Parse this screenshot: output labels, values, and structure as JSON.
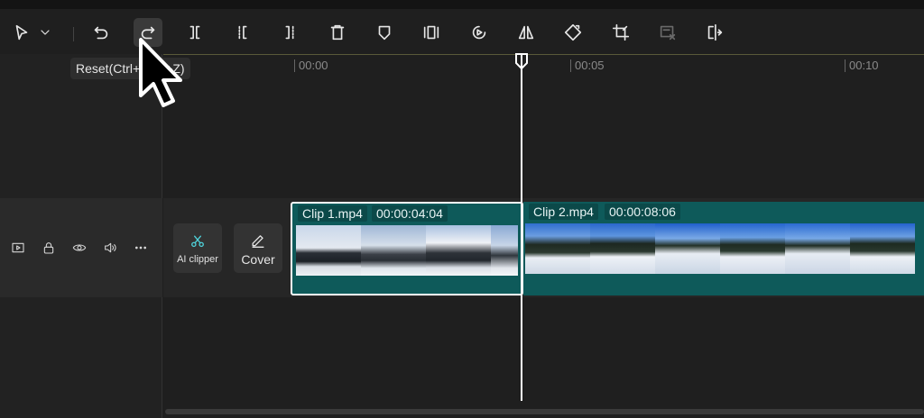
{
  "toolbar": {
    "items": [
      {
        "name": "select-tool-icon"
      },
      {
        "name": "chevron-down-icon"
      },
      {
        "name": "undo-icon"
      },
      {
        "name": "redo-icon"
      },
      {
        "name": "split-icon"
      },
      {
        "name": "split-left-icon"
      },
      {
        "name": "split-right-icon"
      },
      {
        "name": "delete-icon"
      },
      {
        "name": "marker-icon"
      },
      {
        "name": "freeze-frame-icon"
      },
      {
        "name": "speed-icon"
      },
      {
        "name": "mirror-icon"
      },
      {
        "name": "rotate-icon"
      },
      {
        "name": "crop-icon"
      },
      {
        "name": "remove-background-icon"
      },
      {
        "name": "replace-icon"
      }
    ],
    "tooltip": "Reset(Ctrl+Shift+Z)"
  },
  "ruler": {
    "ticks": [
      "00:00",
      "00:05",
      "00:10"
    ]
  },
  "track": {
    "tools": [
      {
        "label": "AI clipper",
        "icon": "ai-clipper-icon"
      },
      {
        "label": "Cover",
        "icon": "pencil-icon"
      }
    ],
    "header_icons": [
      "video-track-icon",
      "lock-icon",
      "eye-icon",
      "volume-icon",
      "more-icon"
    ]
  },
  "clips": [
    {
      "name": "Clip 1.mp4",
      "duration": "00:00:04:04",
      "selected": true
    },
    {
      "name": "Clip 2.mp4",
      "duration": "00:00:08:06",
      "selected": false
    }
  ],
  "colors": {
    "clip_bg": "#0e5a5a",
    "accent": "#4fd1d9"
  }
}
